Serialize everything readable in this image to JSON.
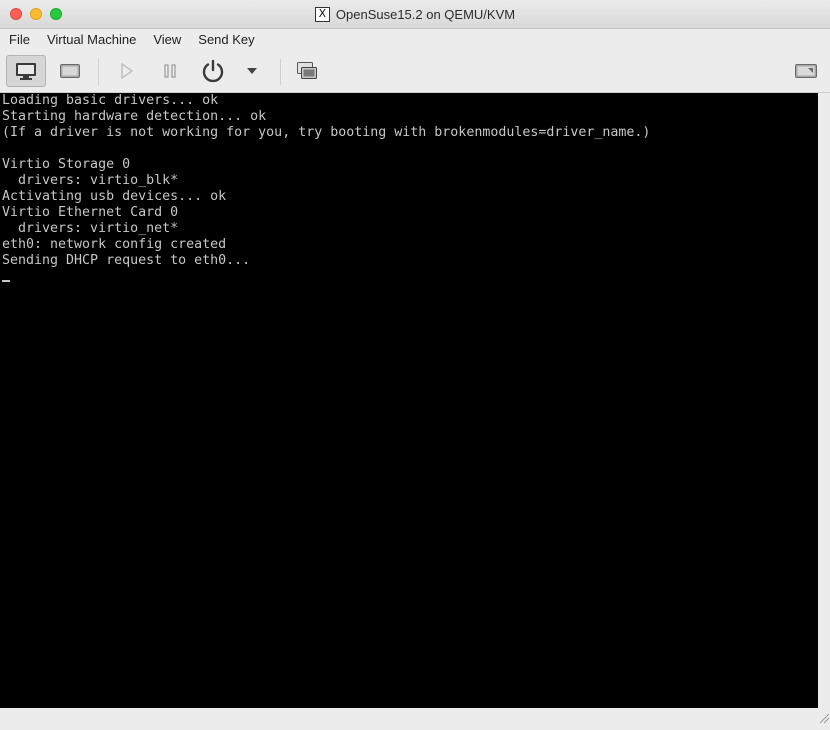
{
  "window": {
    "title": "OpenSuse15.2 on QEMU/KVM",
    "title_icon": "X11-icon",
    "title_icon_glyph": "X"
  },
  "menubar": {
    "items": [
      {
        "label": "File"
      },
      {
        "label": "Virtual Machine"
      },
      {
        "label": "View"
      },
      {
        "label": "Send Key"
      }
    ]
  },
  "toolbar": {
    "buttons": [
      {
        "name": "console",
        "icon": "monitor-icon",
        "active": true
      },
      {
        "name": "details",
        "icon": "details-icon",
        "active": false
      },
      {
        "name": "run",
        "icon": "play-icon",
        "enabled": false
      },
      {
        "name": "pause",
        "icon": "pause-icon",
        "enabled": false
      },
      {
        "name": "shutdown",
        "icon": "power-icon",
        "enabled": true
      },
      {
        "name": "shutdown-menu",
        "icon": "chevron-down-icon",
        "enabled": true
      },
      {
        "name": "snapshots",
        "icon": "snapshot-icon",
        "enabled": true
      },
      {
        "name": "fullscreen",
        "icon": "fullscreen-icon",
        "enabled": true
      }
    ]
  },
  "console": {
    "lines": [
      "Loading basic drivers... ok",
      "Starting hardware detection... ok",
      "(If a driver is not working for you, try booting with brokenmodules=driver_name.)",
      "",
      "Virtio Storage 0",
      "  drivers: virtio_blk*",
      "Activating usb devices... ok",
      "Virtio Ethernet Card 0",
      "  drivers: virtio_net*",
      "eth0: network config created",
      "Sending DHCP request to eth0..."
    ],
    "background": "#000000",
    "text_color": "#c6c6c6"
  }
}
